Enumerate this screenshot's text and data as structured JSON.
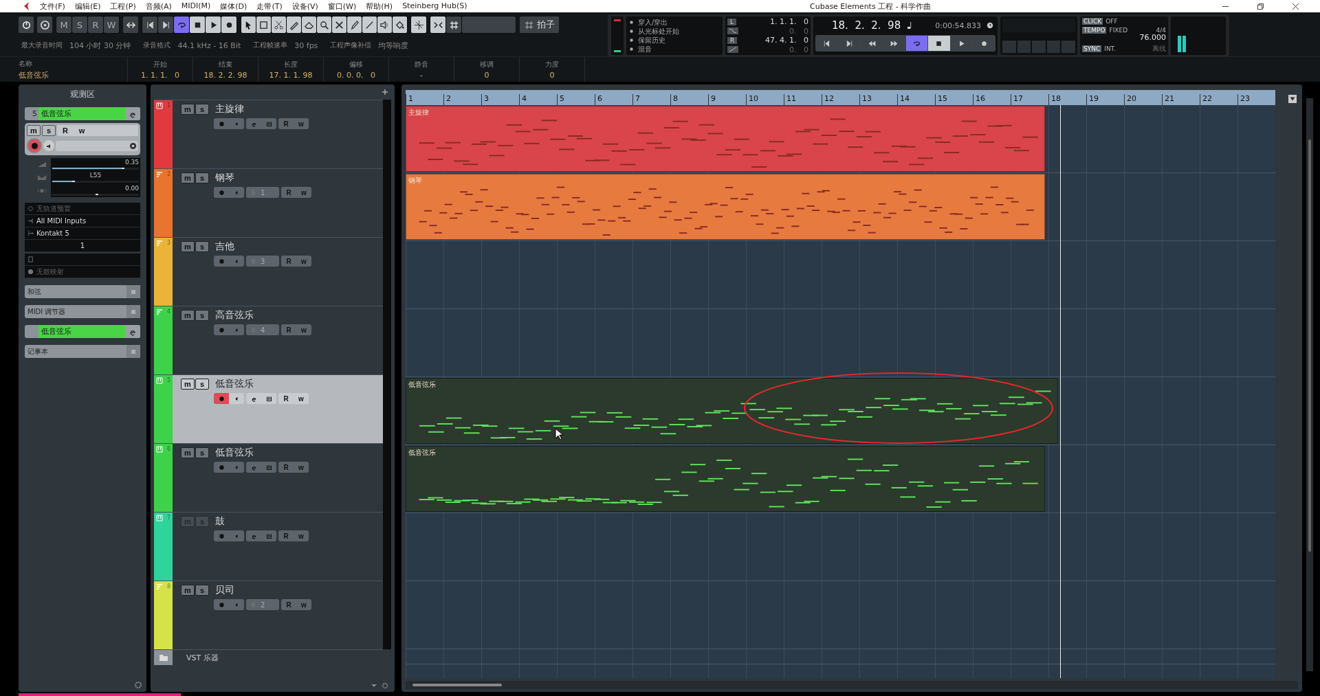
{
  "window": {
    "title": "Cubase Elements 工程 - 科学作曲"
  },
  "menu": [
    "文件(F)",
    "编辑(E)",
    "工程(P)",
    "音频(A)",
    "MIDI(M)",
    "媒体(D)",
    "走带(T)",
    "设备(V)",
    "窗口(W)",
    "帮助(H)",
    "Steinberg Hub(S)"
  ],
  "toolbar": {
    "automation": [
      "M",
      "S",
      "R",
      "W"
    ],
    "cycle_on": true,
    "snap_label": "拍子"
  },
  "status_line": [
    {
      "label": "最大录音时间",
      "value": "104 小时 30 分钟"
    },
    {
      "label": "录音格式",
      "value": "44.1 kHz - 16 Bit"
    },
    {
      "label": "工程帧速率",
      "value": "30 fps"
    },
    {
      "label": "工程声像补偿",
      "value": "均等响度"
    }
  ],
  "info_line": [
    {
      "label": "名称",
      "value": "低音弦乐"
    },
    {
      "label": "开始",
      "value": "1. 1. 1.   0"
    },
    {
      "label": "结束",
      "value": "18. 2. 2. 98"
    },
    {
      "label": "长度",
      "value": "17. 1. 1. 98"
    },
    {
      "label": "偏移",
      "value": "0. 0. 0.   0"
    },
    {
      "label": "静音",
      "value": "-"
    },
    {
      "label": "移调",
      "value": "0"
    },
    {
      "label": "力度",
      "value": "0"
    }
  ],
  "transport": {
    "modes": [
      "穿入/穿出",
      "从光标处开始",
      "保留历史",
      "混音"
    ],
    "left_label": "L",
    "left_locator": "1. 1. 1.   0",
    "left_offset": "0.   0",
    "right_label": "R",
    "right_locator": "47. 4. 1.   0",
    "right_offset": "0.   0",
    "position": "18.  2.  2.  98",
    "time": "0:00:54.833",
    "cycle_on": true,
    "click_label": "CLICK",
    "click_value": "OFF",
    "tempo_label": "TEMPO",
    "tempo_mode": "FIXED",
    "signature": "4/4",
    "bpm": "76.000",
    "sync_label": "SYNC",
    "sync_value": "INT.",
    "sync_status": "离线"
  },
  "inspector": {
    "title": "观测区",
    "track_number": "5",
    "track_name": "低音弦乐",
    "buttons": {
      "mute": "m",
      "solo": "s",
      "read": "R",
      "write": "w"
    },
    "faders": [
      {
        "kind": "volume",
        "value": "0.35",
        "level": 0.8
      },
      {
        "kind": "pan",
        "value": "L55",
        "level": 0.23
      },
      {
        "kind": "delay",
        "value": "0.00",
        "level": 0.5
      }
    ],
    "record_enabled": true,
    "preset": "无轨道预置",
    "input": "All MIDI Inputs",
    "output": "Kontakt 5",
    "channel": "1",
    "drum_map": "无鼓映射",
    "sections": [
      {
        "kind": "folded",
        "label": "和弦"
      },
      {
        "kind": "folded",
        "label": "MIDI 调节器"
      },
      {
        "kind": "instrument",
        "label": "低音弦乐"
      },
      {
        "kind": "folded",
        "label": "记事本"
      }
    ]
  },
  "tracks": [
    {
      "number": "1",
      "name": "主旋律",
      "kind": "instrument",
      "color": "#e03a3e",
      "selected": false,
      "record_enabled": false,
      "mute_solo_disabled": false,
      "buttons": {
        "mute": "m",
        "solo": "s",
        "read": "R",
        "write": "w"
      },
      "part": {
        "name": "主旋律",
        "color": "#d9454b",
        "level": 0.735
      }
    },
    {
      "number": "2",
      "name": "钢琴",
      "kind": "midi",
      "channel": "1",
      "color": "#e8742f",
      "selected": false,
      "record_enabled": false,
      "mute_solo_disabled": false,
      "buttons": {
        "mute": "m",
        "solo": "s",
        "read": "R",
        "write": "w"
      },
      "part": {
        "name": "钢琴",
        "color": "#e77a3f",
        "level": 0.735
      }
    },
    {
      "number": "3",
      "name": "吉他",
      "kind": "midi",
      "channel": "3",
      "color": "#eab43a",
      "selected": false,
      "record_enabled": false,
      "mute_solo_disabled": false,
      "buttons": {
        "mute": "m",
        "solo": "s",
        "read": "R",
        "write": "w"
      }
    },
    {
      "number": "4",
      "name": "高音弦乐",
      "kind": "midi",
      "channel": "4",
      "color": "#3ed24a",
      "selected": false,
      "record_enabled": false,
      "mute_solo_disabled": false,
      "buttons": {
        "mute": "m",
        "solo": "s",
        "read": "R",
        "write": "w"
      }
    },
    {
      "number": "5",
      "name": "低音弦乐",
      "kind": "instrument",
      "color": "#3ed24a",
      "selected": true,
      "record_enabled": true,
      "mute_solo_disabled": false,
      "buttons": {
        "mute": "m",
        "solo": "s",
        "read": "R",
        "write": "w"
      },
      "part": {
        "name": "低音弦乐",
        "color": "#2b3a2c",
        "level": 0.75
      }
    },
    {
      "number": "6",
      "name": "低音弦乐",
      "kind": "instrument",
      "color": "#3ed24a",
      "selected": false,
      "record_enabled": false,
      "mute_solo_disabled": false,
      "buttons": {
        "mute": "m",
        "solo": "s",
        "read": "R",
        "write": "w"
      },
      "part": {
        "name": "低音弦乐",
        "color": "#2b3a2c",
        "level": 0.735
      }
    },
    {
      "number": "7",
      "name": "鼓",
      "kind": "instrument",
      "color": "#2ed49a",
      "selected": false,
      "record_enabled": false,
      "mute_solo_disabled": true,
      "buttons": {
        "mute": "m",
        "solo": "s",
        "read": "R",
        "write": "w"
      }
    },
    {
      "number": "8",
      "name": "贝司",
      "kind": "midi",
      "channel": "2",
      "color": "#d6e24a",
      "selected": false,
      "record_enabled": false,
      "mute_solo_disabled": false,
      "buttons": {
        "mute": "m",
        "solo": "s",
        "read": "R",
        "write": "w"
      }
    }
  ],
  "vst_folder": "VST 乐器",
  "ruler": [
    "1",
    "2",
    "3",
    "4",
    "5",
    "6",
    "7",
    "8",
    "9",
    "10",
    "11",
    "12",
    "13",
    "14",
    "15",
    "16",
    "17",
    "18",
    "19",
    "20",
    "21",
    "22",
    "23"
  ],
  "annotation": {
    "kind": "ellipse",
    "color": "#e0282d"
  }
}
